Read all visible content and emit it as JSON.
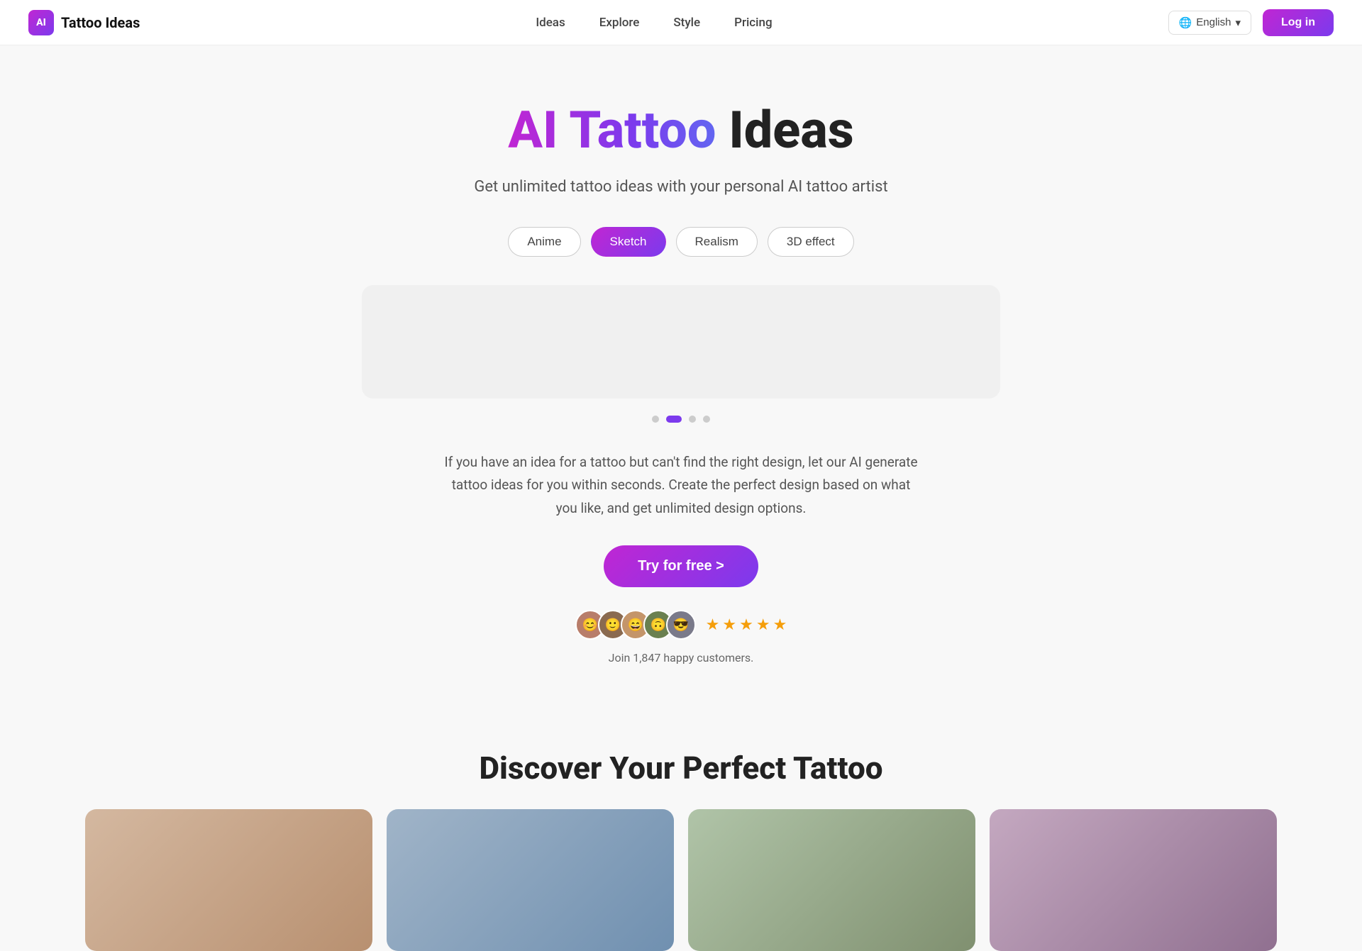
{
  "brand": {
    "logo_initials": "AI",
    "name": "Tattoo Ideas"
  },
  "nav": {
    "links": [
      {
        "id": "ideas",
        "label": "Ideas"
      },
      {
        "id": "explore",
        "label": "Explore"
      },
      {
        "id": "style",
        "label": "Style"
      },
      {
        "id": "pricing",
        "label": "Pricing"
      }
    ],
    "language": "English",
    "login_label": "Log in"
  },
  "hero": {
    "title_gradient": "AI Tattoo",
    "title_plain": " Ideas",
    "subtitle": "Get unlimited tattoo ideas with your personal AI tattoo artist",
    "style_pills": [
      {
        "id": "anime",
        "label": "Anime",
        "active": false
      },
      {
        "id": "sketch",
        "label": "Sketch",
        "active": true
      },
      {
        "id": "realism",
        "label": "Realism",
        "active": false
      },
      {
        "id": "3d-effect",
        "label": "3D effect",
        "active": false
      }
    ],
    "carousel_dots": [
      {
        "active": false
      },
      {
        "active": true
      },
      {
        "active": false
      },
      {
        "active": false
      }
    ],
    "description": "If you have an idea for a tattoo but can't find the right design, let our AI generate tattoo ideas for you within seconds. Create the perfect design based on what you like, and get unlimited design options.",
    "cta_label": "Try for free >",
    "avatars": [
      "👤",
      "👤",
      "👤",
      "👤",
      "👤"
    ],
    "stars": [
      "★",
      "★",
      "★",
      "★",
      "★"
    ],
    "social_proof_label": "Join 1,847 happy customers."
  },
  "discover": {
    "title": "Discover Your Perfect Tattoo",
    "cards": [
      {
        "id": "card-1"
      },
      {
        "id": "card-2"
      },
      {
        "id": "card-3"
      },
      {
        "id": "card-4"
      }
    ]
  }
}
